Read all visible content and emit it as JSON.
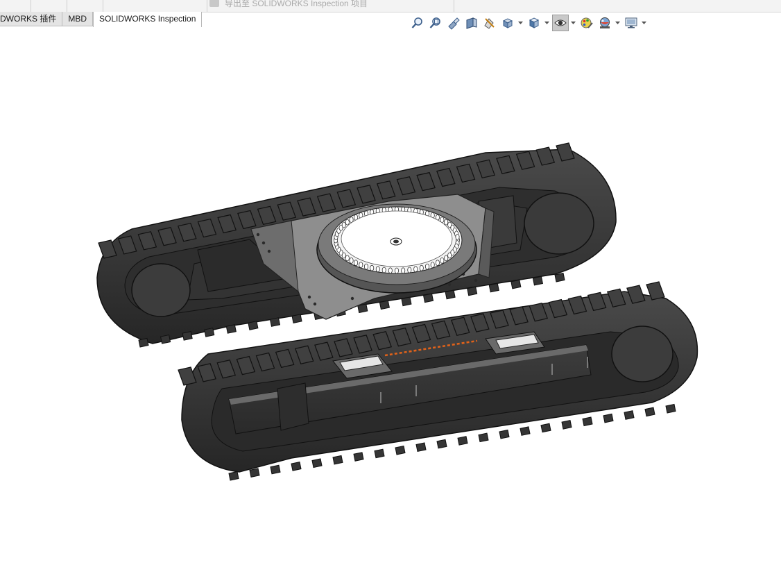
{
  "top_strip": {
    "faded_item_label": "导出至 SOLIDWORKS Inspection 项目"
  },
  "tabs": [
    {
      "label": "DWORKS 插件",
      "active": false
    },
    {
      "label": "MBD",
      "active": false
    },
    {
      "label": "SOLIDWORKS Inspection",
      "active": true
    }
  ],
  "view_toolbar": {
    "icons": [
      "zoom-to-fit-icon",
      "zoom-to-area-icon",
      "previous-view-icon",
      "section-view-icon",
      "dynamic-annotation-icon",
      "view-orientation-icon",
      "display-style-icon",
      "hide-show-items-icon",
      "edit-appearance-icon",
      "apply-scene-icon",
      "view-settings-icon"
    ]
  },
  "model": {
    "name": "crawler-undercarriage",
    "colors": {
      "track": "#3a3a3a",
      "track_edge": "#1b1b1b",
      "frame": "#9a9a9a",
      "bearing": "#ffffff",
      "highlight": "#e0621a"
    }
  }
}
